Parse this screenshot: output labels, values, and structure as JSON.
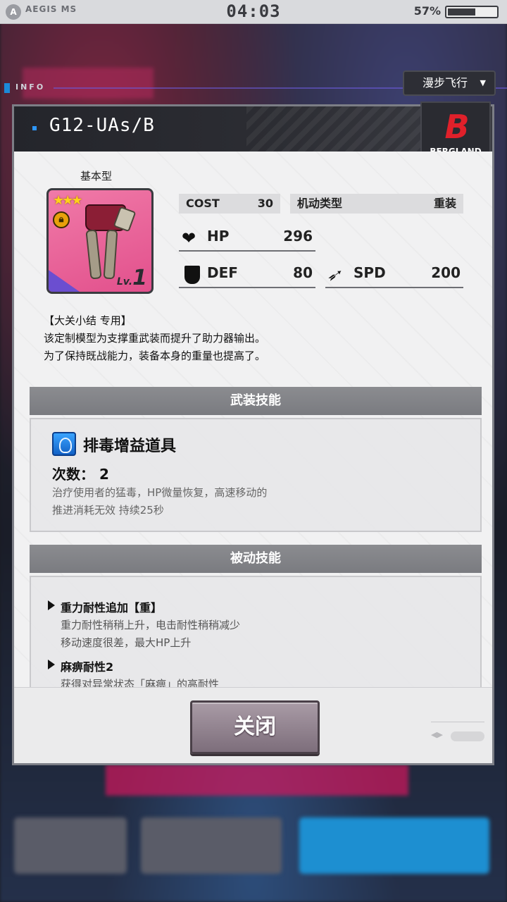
{
  "status_bar": {
    "brand": "AEGIS MS",
    "time": "04:03",
    "battery_percent": "57%",
    "battery_level": 0.57
  },
  "info_strip": {
    "label": "INFO"
  },
  "mode_dropdown": {
    "selected": "漫步飞行",
    "caret": "▼"
  },
  "panel": {
    "title": "G12-UAs/B",
    "brand": "BERGLAND",
    "brand_letter": "B",
    "equipment": {
      "type_label": "基本型",
      "rarity_stars": "★★★",
      "level_label": "Lv.",
      "level_value": "1",
      "lock_icon": "lock-icon"
    },
    "stats": {
      "cost_label": "COST",
      "cost_value": "30",
      "mobility_label": "机动类型",
      "mobility_value": "重装",
      "hp_label": "HP",
      "hp_value": "296",
      "def_label": "DEF",
      "def_value": "80",
      "spd_label": "SPD",
      "spd_value": "200"
    },
    "description": {
      "line1": "【大关小结 专用】",
      "line2": "该定制模型为支撑重武装而提升了助力器输出。",
      "line3": "为了保持既战能力，装备本身的重量也提高了。"
    },
    "weapon_skill": {
      "header": "武装技能",
      "name": "排毒增益道具",
      "count_label": "次数：",
      "count_value": "2",
      "desc_line1": "治疗使用者的猛毒，HP微量恢复，高速移动的",
      "desc_line2": "推进消耗无效 持续25秒"
    },
    "passive_skill": {
      "header": "被动技能",
      "items": [
        {
          "name": "重力耐性追加【重】",
          "desc_line1": "重力耐性稍稍上升，电击耐性稍稍减少",
          "desc_line2": "移动速度很差，最大HP上升"
        },
        {
          "name": "麻痹耐性2",
          "desc_line1": "获得对异常状态「麻痹」的高耐性",
          "desc_line2": ""
        }
      ]
    },
    "close_button": "关闭"
  }
}
